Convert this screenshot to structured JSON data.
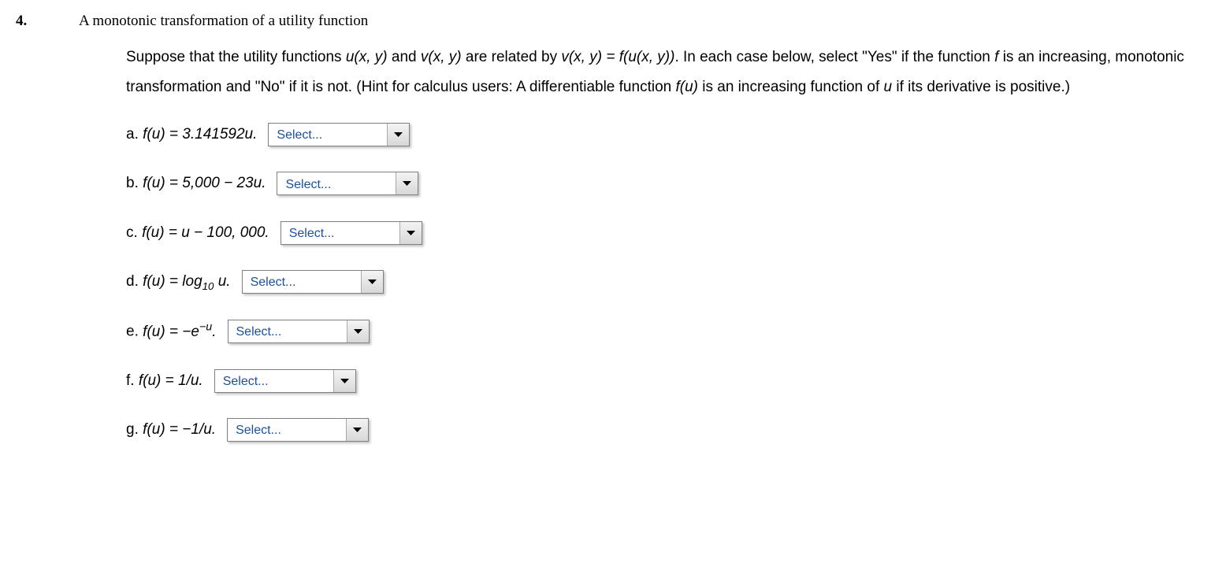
{
  "question_number": "4.",
  "heading": "A monotonic transformation of a utility function",
  "body": {
    "p1_a": "Suppose that the utility functions ",
    "p1_b": " and ",
    "p1_c": " are related by ",
    "p1_d": ".   In each case below, select \"Yes\" if the function ",
    "p1_e": " is an increasing, monotonic transformation and \"No\" if it is not.   (Hint for calculus users: A differentiable function ",
    "p1_f": " is an increasing function of ",
    "p1_g": " if its derivative is positive.)"
  },
  "math": {
    "uxy": "u(x, y)",
    "vxy": "v(x, y)",
    "rel": "v(x, y) = f(u(x, y))",
    "f": "f",
    "fu": "f(u)",
    "u": "u"
  },
  "select_placeholder": "Select...",
  "items": {
    "a": {
      "letter": "a.",
      "pre": "f(u) = 3.141592u."
    },
    "b": {
      "letter": "b.",
      "pre": "f(u) = 5,000 − 23u."
    },
    "c": {
      "letter": "c.",
      "pre": "f(u) = u − 100, 000."
    },
    "d": {
      "letter": "d."
    },
    "e": {
      "letter": "e."
    },
    "f": {
      "letter": "f.",
      "pre": "f(u) = 1/u."
    },
    "g": {
      "letter": "g.",
      "pre": "f(u) = −1/u."
    }
  }
}
